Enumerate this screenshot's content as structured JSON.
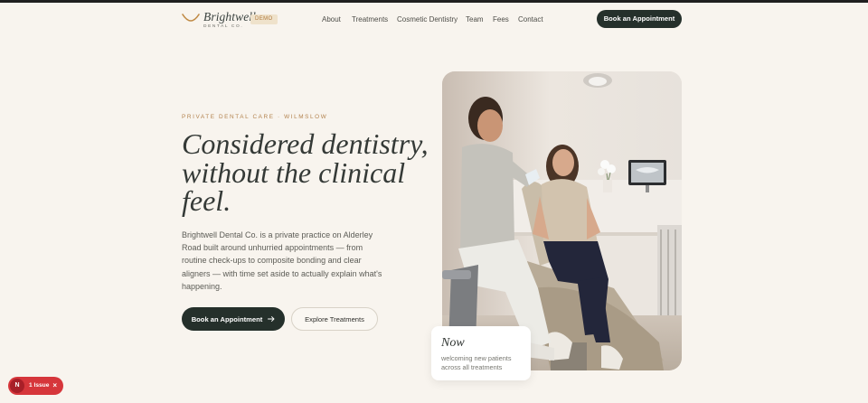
{
  "header": {
    "logo_name": "Brightwell",
    "logo_sub": "DENTAL CO.",
    "badge": "DEMO",
    "nav": [
      "About",
      "Treatments",
      "Cosmetic Dentistry",
      "Team",
      "Fees",
      "Contact"
    ],
    "cta": "Book an Appointment"
  },
  "hero": {
    "eyebrow": "PRIVATE DENTAL CARE · WILMSLOW",
    "title_lines": [
      "Considered dentistry,",
      "without the clinical",
      "feel."
    ],
    "body": "Brightwell Dental Co. is a private practice on Alderley Road built around unhurried appointments — from routine check-ups to composite bonding and clear aligners — with time set aside to actually explain what's happening.",
    "primary_button": "Book an Appointment",
    "secondary_button": "Explore Treatments"
  },
  "now_card": {
    "title": "Now",
    "text": "welcoming new patients across all treatments"
  },
  "issue_badge": {
    "icon_letter": "N",
    "label": "1 Issue",
    "close": "×"
  },
  "colors": {
    "background": "#f8f4ee",
    "dark_green": "#25302b",
    "accent_gold": "#b3834f",
    "issue_red": "#d6363b"
  },
  "icons": {
    "logo": "smile-icon",
    "button_arrow": "arrow-right-icon",
    "issue": "n-icon",
    "close": "close-icon"
  }
}
